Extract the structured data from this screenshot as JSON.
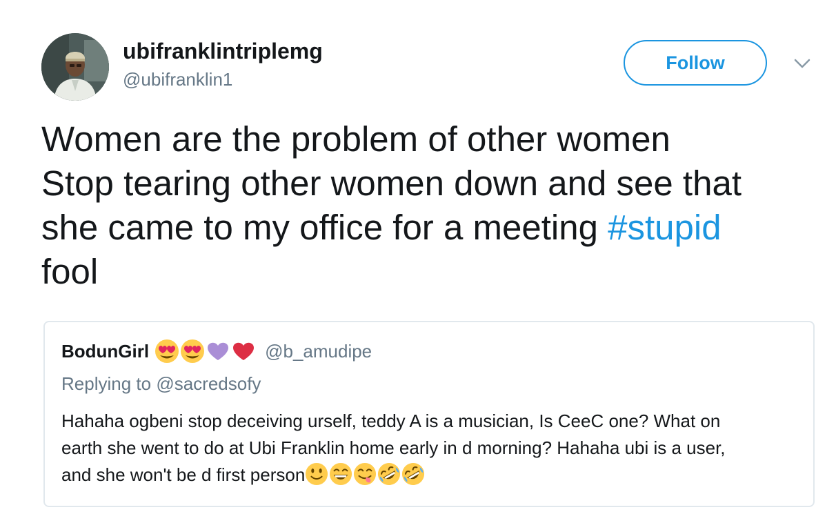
{
  "tweet": {
    "author": {
      "display_name": "ubifranklintriplemg",
      "handle": "@ubifranklin1",
      "avatar_icon": "profile-photo"
    },
    "follow_label": "Follow",
    "menu_icon": "chevron-down-icon",
    "text_lines": [
      "Women are the problem of other women",
      "Stop tearing other women down and see that",
      "she came to my office for a meeting "
    ],
    "hashtag": "#stupid",
    "text_last_line": "fool"
  },
  "quoted_tweet": {
    "display_name": "BodunGirl",
    "name_emojis": [
      "heart-eyes-emoji",
      "heart-eyes-emoji",
      "purple-heart-emoji",
      "red-heart-emoji"
    ],
    "handle": "@b_amudipe",
    "replying_prefix": "Replying to ",
    "replying_to": "@sacredsofy",
    "body_lines": [
      "Hahaha ogbeni stop deceiving urself, teddy A is a musician, Is CeeC one? What on",
      "earth she went to do at Ubi Franklin home early in d morning? Hahaha ubi is a user,",
      "and she won't be d first person"
    ],
    "body_emojis": [
      "slightly-smiling-emoji",
      "grinning-squinting-emoji",
      "yum-emoji",
      "rofl-emoji",
      "rofl-emoji"
    ]
  },
  "colors": {
    "link_blue": "#1b95e0",
    "secondary_text": "#657786",
    "primary_text": "#14171a",
    "card_border": "#e1e8ed"
  }
}
